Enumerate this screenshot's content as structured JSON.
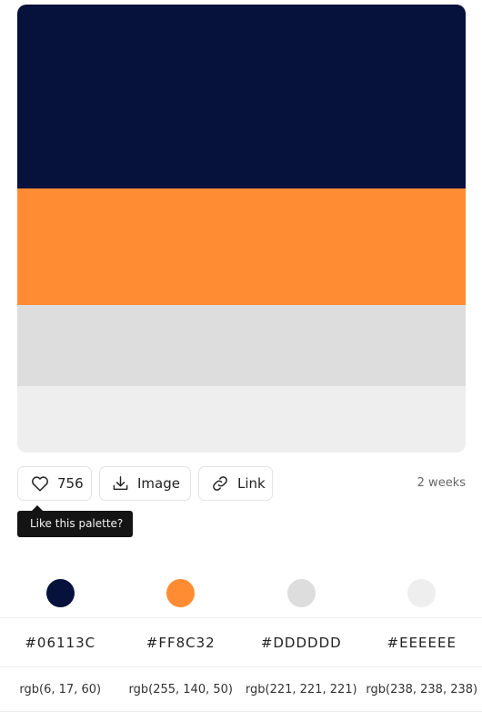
{
  "palette": {
    "colors": [
      "#06113C",
      "#FF8C32",
      "#DDDDDD",
      "#EEEEEE"
    ]
  },
  "actions": {
    "like_count": "756",
    "image_label": "Image",
    "link_label": "Link",
    "age": "2 weeks"
  },
  "tooltip": {
    "text": "Like this palette?"
  },
  "details": {
    "hex": [
      "#06113C",
      "#FF8C32",
      "#DDDDDD",
      "#EEEEEE"
    ],
    "rgb": [
      "rgb(6, 17, 60)",
      "rgb(255, 140, 50)",
      "rgb(221, 221, 221)",
      "rgb(238, 238, 238)"
    ]
  },
  "icons": {
    "like": "heart-icon",
    "image": "download-icon",
    "link": "link-icon"
  }
}
